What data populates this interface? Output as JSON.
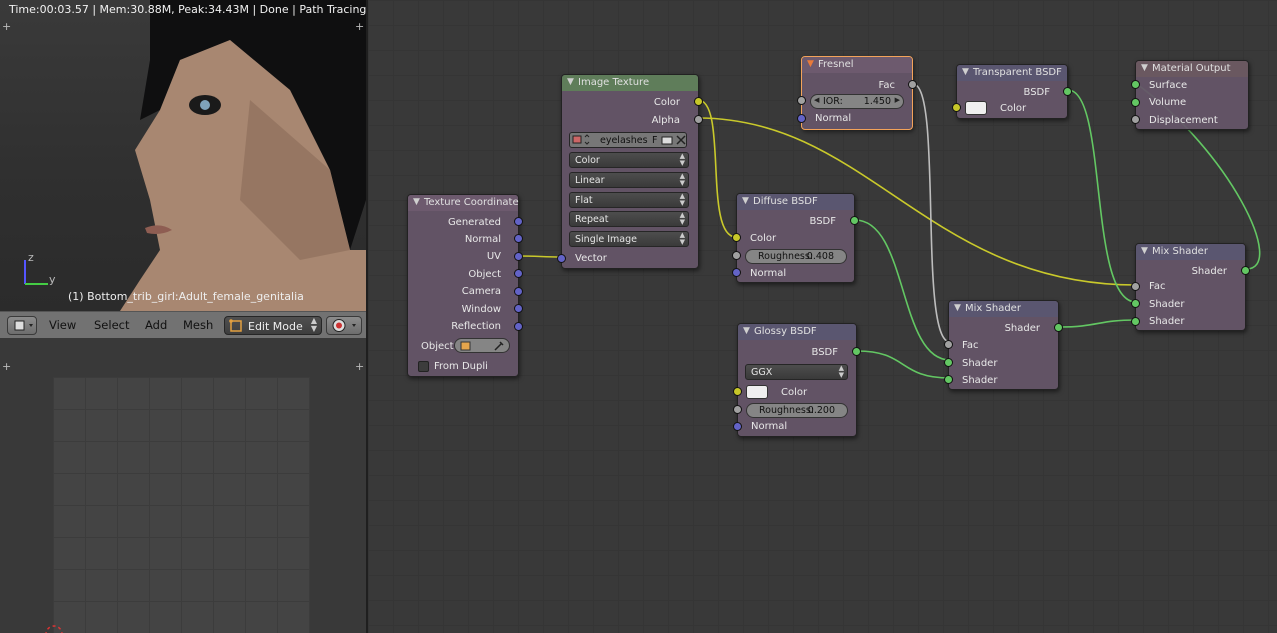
{
  "render_view": {
    "status": "Time:00:03.57 | Mem:30.88M, Peak:34.43M | Done | Path Tracing Sam",
    "object_label": "(1) Bottom_trib_girl:Adult_female_genitalia",
    "axis_z": "z",
    "axis_y": "y"
  },
  "header": {
    "menu": [
      "View",
      "Select",
      "Add",
      "Mesh"
    ],
    "mode": "Edit Mode"
  },
  "nodes": {
    "image_texture": {
      "title": "Image Texture",
      "out_color": "Color",
      "out_alpha": "Alpha",
      "image_name": "eyelashes",
      "fake_user": "F",
      "color_space": "Color",
      "interpolation": "Linear",
      "projection": "Flat",
      "extension": "Repeat",
      "source": "Single Image",
      "in_vector": "Vector"
    },
    "texture_coordinate": {
      "title": "Texture Coordinate",
      "outputs": [
        "Generated",
        "Normal",
        "UV",
        "Object",
        "Camera",
        "Window",
        "Reflection"
      ],
      "object_label": "Object",
      "from_dupli": "From Dupli"
    },
    "fresnel": {
      "title": "Fresnel",
      "out_fac": "Fac",
      "ior_label": "IOR:",
      "ior_value": "1.450",
      "in_normal": "Normal"
    },
    "transparent_bsdf": {
      "title": "Transparent BSDF",
      "out_bsdf": "BSDF",
      "in_color": "Color"
    },
    "material_output": {
      "title": "Material Output",
      "inputs": [
        "Surface",
        "Volume",
        "Displacement"
      ]
    },
    "diffuse_bsdf": {
      "title": "Diffuse BSDF",
      "out_bsdf": "BSDF",
      "in_color": "Color",
      "roughness_label": "Roughness:",
      "roughness_value": "0.408",
      "in_normal": "Normal"
    },
    "glossy_bsdf": {
      "title": "Glossy BSDF",
      "out_bsdf": "BSDF",
      "distribution": "GGX",
      "in_color": "Color",
      "roughness_label": "Roughness:",
      "roughness_value": "0.200",
      "in_normal": "Normal"
    },
    "mix_shader_1": {
      "title": "Mix Shader",
      "out_shader": "Shader",
      "in_fac": "Fac",
      "in_shader_1": "Shader",
      "in_shader_2": "Shader"
    },
    "mix_shader_2": {
      "title": "Mix Shader",
      "out_shader": "Shader",
      "in_fac": "Fac",
      "in_shader_1": "Shader",
      "in_shader_2": "Shader"
    }
  },
  "colors": {
    "node_body": "#655568",
    "selected_outline": "#f3a35a",
    "link": "#c9c92b",
    "socket_color": "#c7c729",
    "socket_vector": "#6363c7",
    "socket_shader": "#63c763",
    "socket_float": "#a1a1a1"
  }
}
